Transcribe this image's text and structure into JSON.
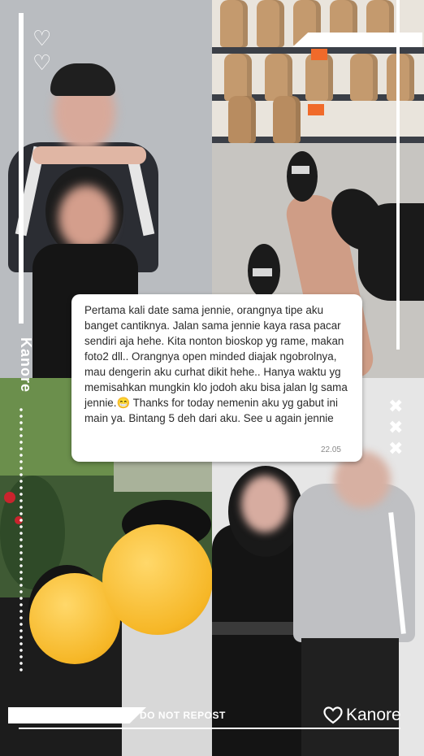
{
  "message": {
    "text": "Pertama kali date sama jennie, orangnya tipe aku banget cantiknya. Jalan sama jennie kaya rasa pacar sendiri aja hehe. Kita nonton bioskop yg rame, makan foto2 dll.. Orangnya open minded diajak ngobrolnya, mau dengerin aku curhat dikit hehe.. Hanya waktu yg memisahkan mungkin klo jodoh aku bisa jalan lg sama jennie.😁 Thanks for today nemenin aku yg gabut ini main ya. Bintang 5 deh dari aku. See u again jennie",
    "time": "22.05"
  },
  "watermark": {
    "vertical": "Kanore",
    "do_not_repost": "DO NOT REPOST",
    "brand": "Kanore",
    "brand_icon": "heart-outline-icon"
  },
  "decor": {
    "hearts": [
      "♡",
      "♡"
    ],
    "x_marks": [
      "✖",
      "✖",
      "✖"
    ]
  },
  "colors": {
    "frame": "#ffffff",
    "bubble_bg": "#ffffff",
    "price_tag": "#f06a2a"
  }
}
